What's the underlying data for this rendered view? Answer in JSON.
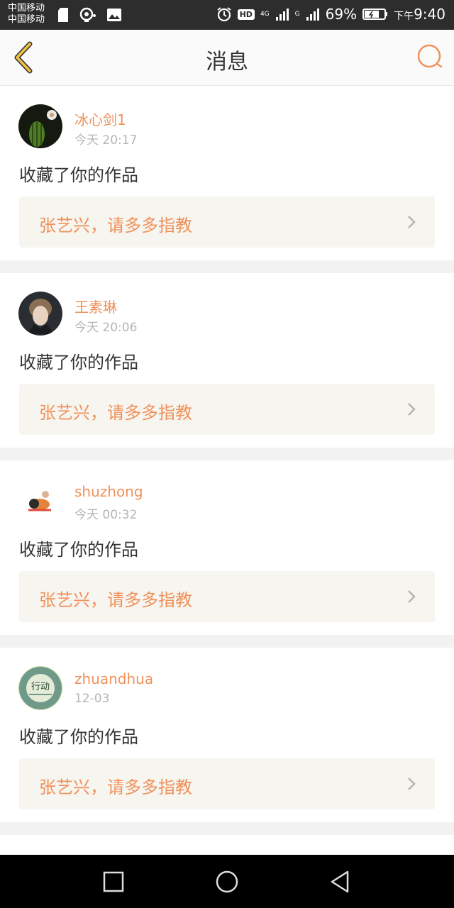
{
  "status_bar": {
    "carrier1": "中国移动",
    "carrier2": "中国移动",
    "hd": "HD",
    "net1": "4G",
    "net2": "G",
    "battery": "69%",
    "time_prefix": "下午",
    "time": "9:40",
    "icons": [
      "sd-card-icon",
      "hotspot-icon",
      "image-icon",
      "alarm-icon",
      "signal-icon",
      "battery-icon"
    ]
  },
  "header": {
    "title": "消息",
    "back_icon": "chevron-left-icon",
    "search_icon": "search-icon",
    "accent_color": "#f0915b"
  },
  "messages": [
    {
      "username": "冰心剑1",
      "time": "今天 20:17",
      "action": "收藏了你的作品",
      "work_title": "张艺兴，请多多指教",
      "avatar": "cactus-avatar"
    },
    {
      "username": "王素琳",
      "time": "今天 20:06",
      "action": "收藏了你的作品",
      "work_title": "张艺兴，请多多指教",
      "avatar": "portrait-avatar"
    },
    {
      "username": "shuzhong",
      "time": "今天 00:32",
      "action": "收藏了你的作品",
      "work_title": "张艺兴，请多多指教",
      "avatar": "cartoon-avatar"
    },
    {
      "username": "zhuandhua",
      "time": "12-03",
      "action": "收藏了你的作品",
      "work_title": "张艺兴，请多多指教",
      "avatar": "action-avatar",
      "avatar_text": "行动"
    }
  ],
  "nav_bar": {
    "icons": [
      "recents-square-icon",
      "home-circle-icon",
      "back-triangle-icon"
    ]
  }
}
